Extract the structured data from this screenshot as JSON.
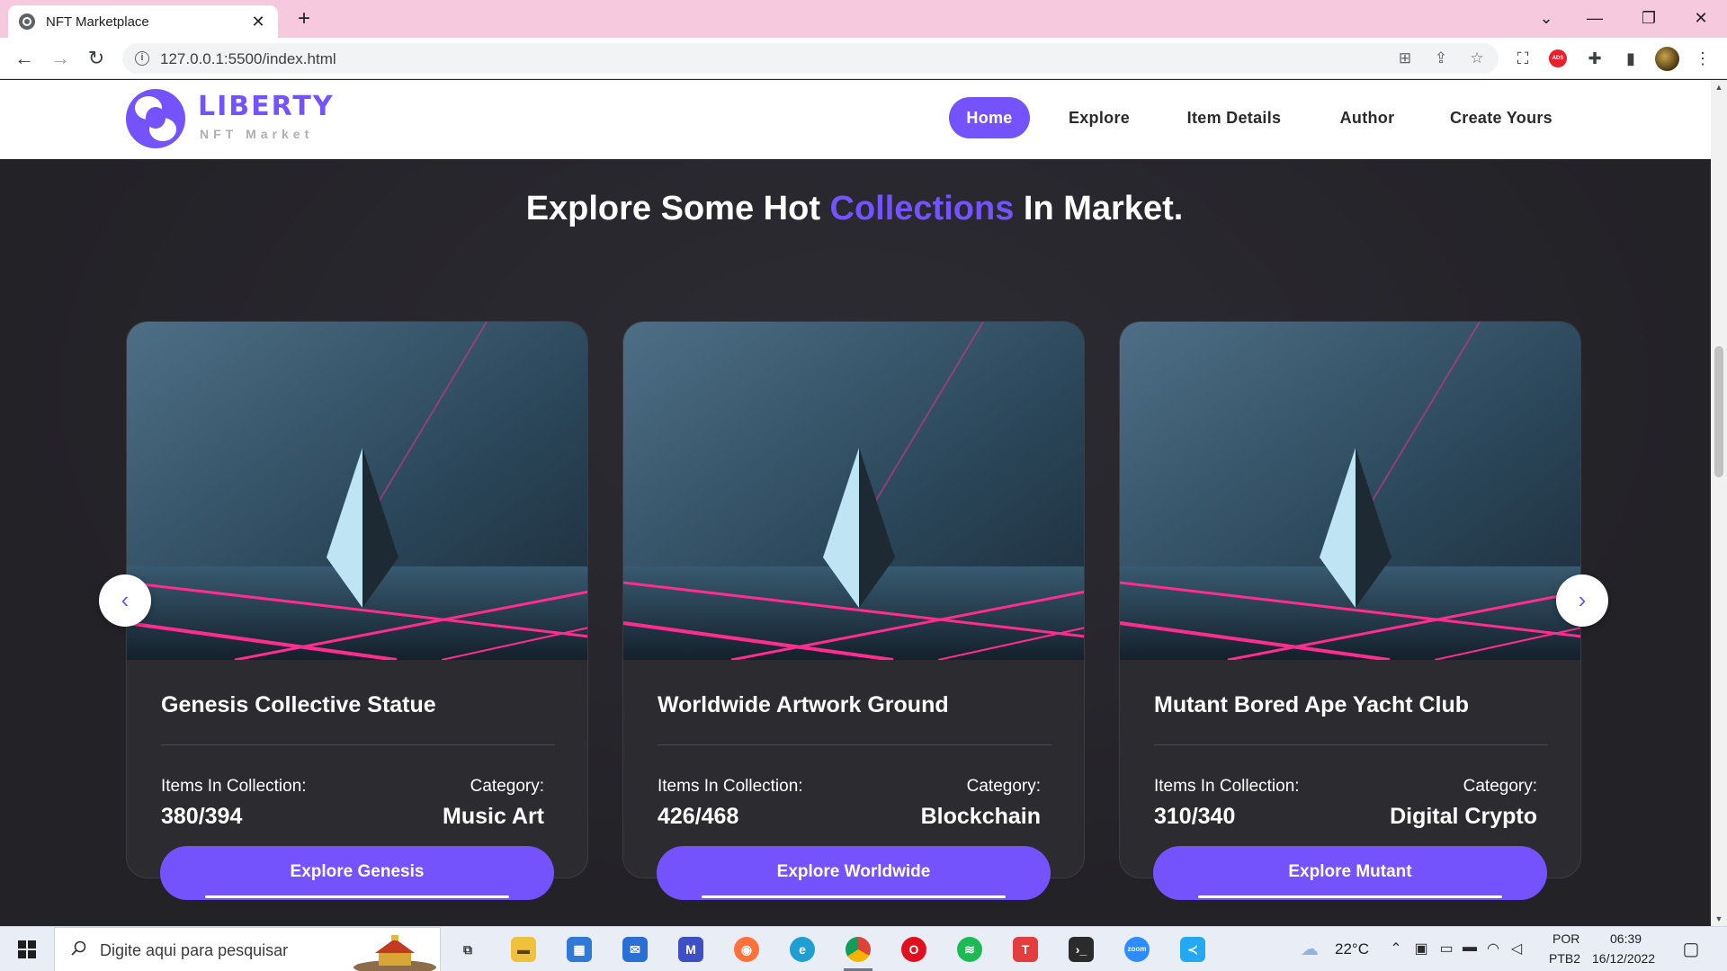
{
  "browser": {
    "tab_title": "NFT Marketplace",
    "tab_close": "✕",
    "new_tab": "+",
    "url": "127.0.0.1:5500/index.html",
    "window_controls": [
      "⌄",
      "—",
      "❐",
      "✕"
    ],
    "icons": [
      "back-arrow-icon",
      "forward-arrow-icon",
      "reload-icon",
      "translate-icon",
      "share-icon",
      "star-bookmark-icon",
      "screen-capture-icon",
      "ad-block-extension-icon",
      "extensions-puzzle-icon",
      "side-panel-icon",
      "profile-avatar-icon",
      "menu-kebab-icon"
    ]
  },
  "site": {
    "logo": {
      "name": "LIBERTY",
      "tagline": "NFT Market"
    },
    "nav": [
      {
        "label": "Home",
        "active": true
      },
      {
        "label": "Explore",
        "active": false
      },
      {
        "label": "Item Details",
        "active": false
      },
      {
        "label": "Author",
        "active": false
      },
      {
        "label": "Create Yours",
        "active": false
      }
    ],
    "accent_color": "#7453fc",
    "section": {
      "title_before": "Explore Some Hot ",
      "title_accent": "Collections",
      "title_after": " In Market."
    },
    "carousel": {
      "prev": "‹",
      "next": "›"
    },
    "collections": [
      {
        "title": "Genesis Collective Statue",
        "items_label": "Items In Collection:",
        "items_value": "380/394",
        "category_label": "Category:",
        "category_value": "Music Art",
        "button": "Explore Genesis"
      },
      {
        "title": "Worldwide Artwork Ground",
        "items_label": "Items In Collection:",
        "items_value": "426/468",
        "category_label": "Category:",
        "category_value": "Blockchain",
        "button": "Explore Worldwide"
      },
      {
        "title": "Mutant Bored Ape Yacht Club",
        "items_label": "Items In Collection:",
        "items_value": "310/340",
        "category_label": "Category:",
        "category_value": "Digital Crypto",
        "button": "Explore Mutant"
      }
    ]
  },
  "taskbar": {
    "search_placeholder": "Digite aqui para pesquisar",
    "apps": [
      "task-view-icon",
      "file-explorer-icon",
      "microsoft-store-icon",
      "mail-icon",
      "mathcad-icon",
      "firefox-icon",
      "edge-icon",
      "chrome-icon",
      "opera-icon",
      "spotify-icon",
      "typora-icon",
      "terminal-icon",
      "zoom-icon",
      "vscode-icon"
    ],
    "weather": "22°C",
    "language": "POR",
    "keyboard": "PTB2",
    "time": "06:39",
    "date": "16/12/2022"
  }
}
